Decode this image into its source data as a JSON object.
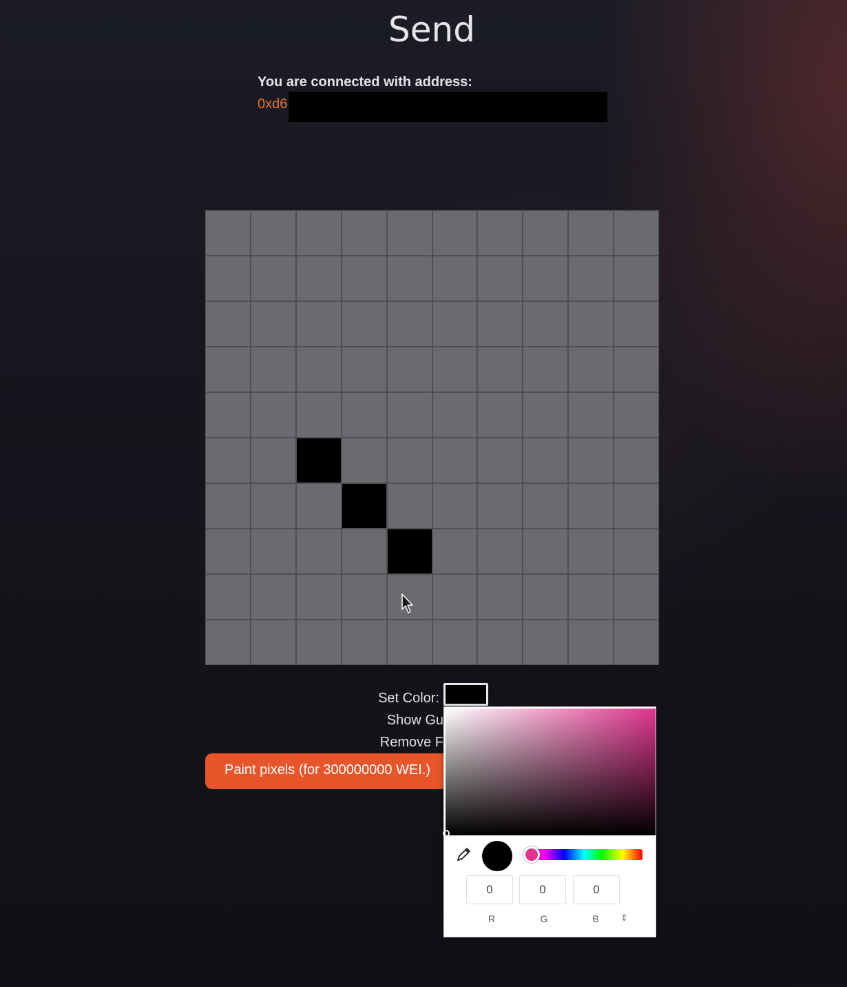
{
  "header": {
    "title": "Send"
  },
  "connection": {
    "label": "You are connected with address:",
    "address_prefix": "0xd6"
  },
  "canvas": {
    "rows": 10,
    "cols": 10,
    "empty_color": "#6b6b6f",
    "painted_cells": [
      {
        "row": 5,
        "col": 2,
        "color": "#000000"
      },
      {
        "row": 6,
        "col": 3,
        "color": "#000000"
      },
      {
        "row": 7,
        "col": 4,
        "color": "#000000"
      }
    ]
  },
  "controls": {
    "set_color_label": "Set Color:",
    "show_grid_label": "Show Gu",
    "remove_label": "Remove F",
    "current_color": "#000000",
    "paint_button": "Paint pixels (for 300000000 WEI.)"
  },
  "color_picker": {
    "hue_color": "#e0358e",
    "r": "0",
    "g": "0",
    "b": "0",
    "r_label": "R",
    "g_label": "G",
    "b_label": "B",
    "mode_toggle": "⇕"
  },
  "colors": {
    "accent": "#e8552a",
    "address": "#e8762c"
  }
}
